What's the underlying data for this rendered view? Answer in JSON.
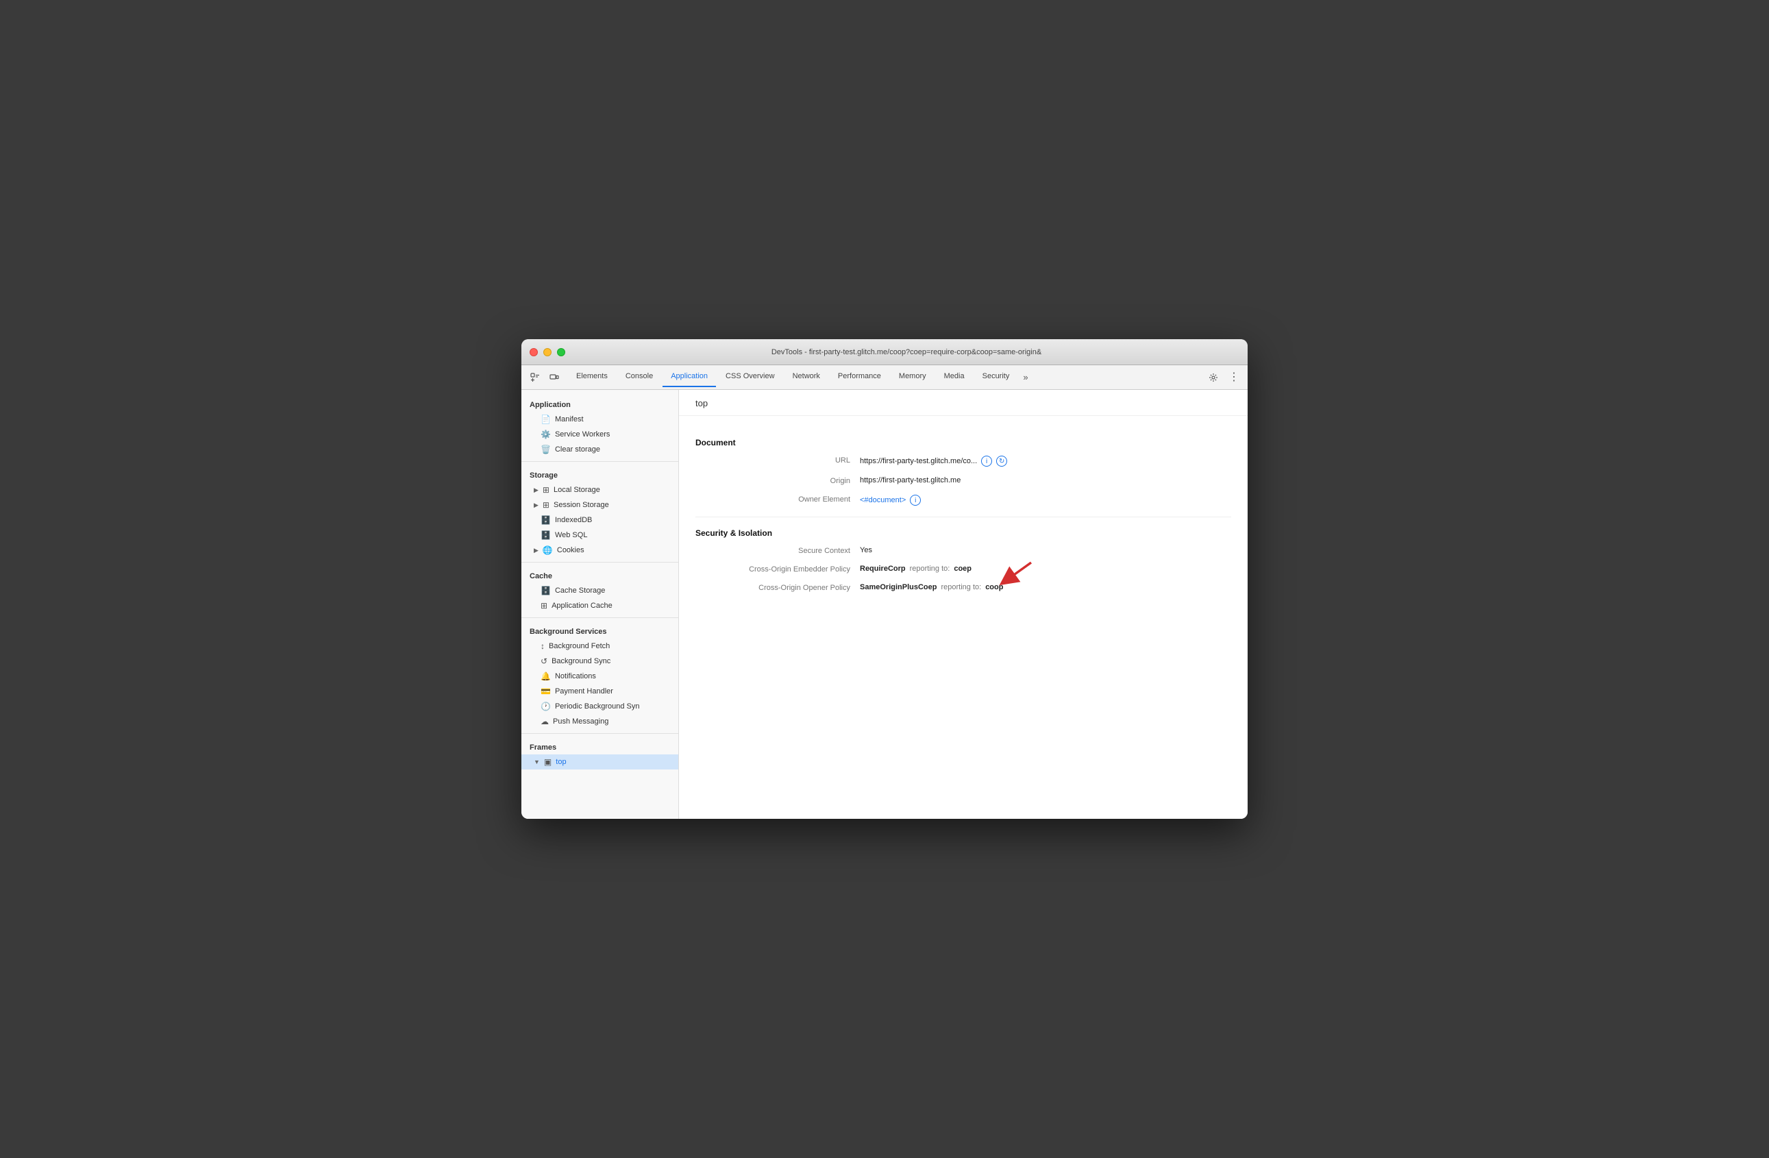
{
  "titlebar": {
    "title": "DevTools - first-party-test.glitch.me/coop?coep=require-corp&coop=same-origin&"
  },
  "tabs": [
    {
      "id": "elements",
      "label": "Elements",
      "active": false
    },
    {
      "id": "console",
      "label": "Console",
      "active": false
    },
    {
      "id": "application",
      "label": "Application",
      "active": true
    },
    {
      "id": "css-overview",
      "label": "CSS Overview",
      "active": false
    },
    {
      "id": "network",
      "label": "Network",
      "active": false
    },
    {
      "id": "performance",
      "label": "Performance",
      "active": false
    },
    {
      "id": "memory",
      "label": "Memory",
      "active": false
    },
    {
      "id": "media",
      "label": "Media",
      "active": false
    },
    {
      "id": "security",
      "label": "Security",
      "active": false
    }
  ],
  "sidebar": {
    "application_label": "Application",
    "manifest_label": "Manifest",
    "service_workers_label": "Service Workers",
    "clear_storage_label": "Clear storage",
    "storage_label": "Storage",
    "local_storage_label": "Local Storage",
    "session_storage_label": "Session Storage",
    "indexeddb_label": "IndexedDB",
    "web_sql_label": "Web SQL",
    "cookies_label": "Cookies",
    "cache_label": "Cache",
    "cache_storage_label": "Cache Storage",
    "application_cache_label": "Application Cache",
    "background_services_label": "Background Services",
    "background_fetch_label": "Background Fetch",
    "background_sync_label": "Background Sync",
    "notifications_label": "Notifications",
    "payment_handler_label": "Payment Handler",
    "periodic_background_sync_label": "Periodic Background Syn",
    "push_messaging_label": "Push Messaging",
    "frames_label": "Frames",
    "top_label": "top"
  },
  "panel": {
    "title": "top",
    "document_section": "Document",
    "url_label": "URL",
    "url_value": "https://first-party-test.glitch.me/co...",
    "origin_label": "Origin",
    "origin_value": "https://first-party-test.glitch.me",
    "owner_element_label": "Owner Element",
    "owner_element_value": "<#document>",
    "security_section": "Security & Isolation",
    "secure_context_label": "Secure Context",
    "secure_context_value": "Yes",
    "coep_label": "Cross-Origin Embedder Policy",
    "coep_policy_value": "RequireCorp",
    "coep_reporting_text": "reporting to:",
    "coep_reporting_value": "coep",
    "coop_label": "Cross-Origin Opener Policy",
    "coop_policy_value": "SameOriginPlusCoep",
    "coop_reporting_text": "reporting to:",
    "coop_reporting_value": "coop"
  }
}
